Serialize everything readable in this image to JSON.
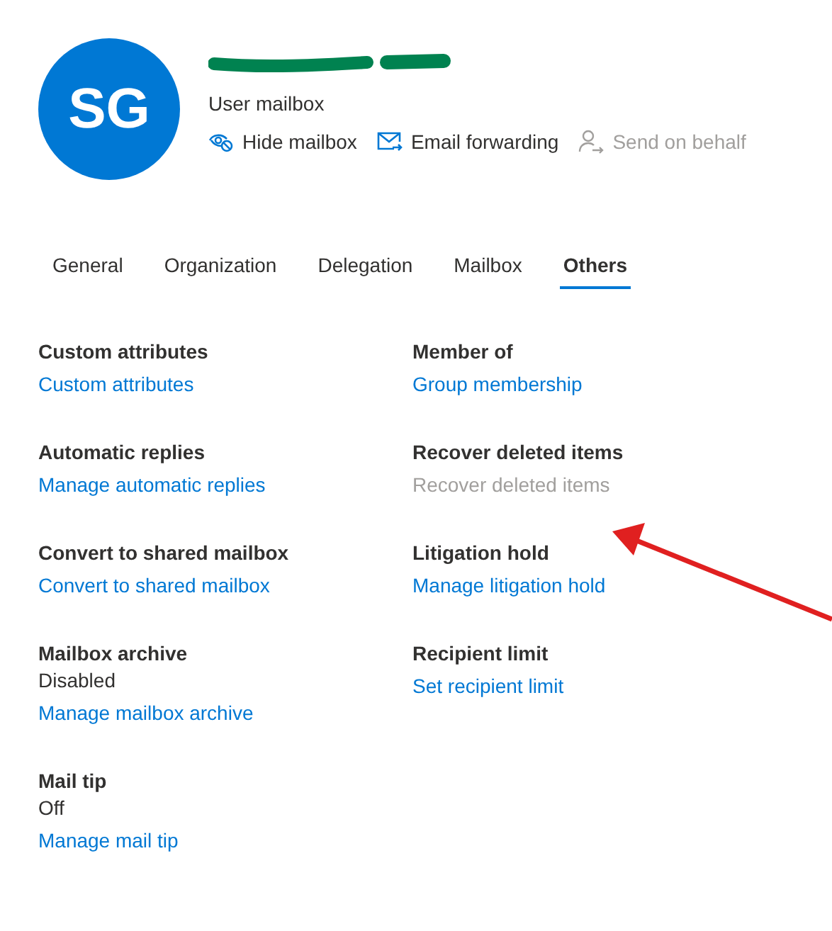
{
  "header": {
    "initials": "SG",
    "name_redacted": true,
    "subtitle": "User mailbox",
    "actions": [
      {
        "label": "Hide mailbox",
        "kind": "hide",
        "disabled": false
      },
      {
        "label": "Email forwarding",
        "kind": "forward",
        "disabled": false
      },
      {
        "label": "Send on behalf",
        "kind": "behalf",
        "disabled": true
      }
    ]
  },
  "tabs": [
    {
      "label": "General",
      "selected": false
    },
    {
      "label": "Organization",
      "selected": false
    },
    {
      "label": "Delegation",
      "selected": false
    },
    {
      "label": "Mailbox",
      "selected": false
    },
    {
      "label": "Others",
      "selected": true
    }
  ],
  "columns": [
    [
      {
        "title": "Custom attributes",
        "link": {
          "label": "Custom attributes",
          "disabled": false
        }
      },
      {
        "title": "Automatic replies",
        "link": {
          "label": "Manage automatic replies",
          "disabled": false
        }
      },
      {
        "title": "Convert to shared mailbox",
        "link": {
          "label": "Convert to shared mailbox",
          "disabled": false
        }
      },
      {
        "title": "Mailbox archive",
        "status": "Disabled",
        "link": {
          "label": "Manage mailbox archive",
          "disabled": false
        }
      },
      {
        "title": "Mail tip",
        "status": "Off",
        "link": {
          "label": "Manage mail tip",
          "disabled": false
        }
      }
    ],
    [
      {
        "title": "Member of",
        "link": {
          "label": "Group membership",
          "disabled": false
        }
      },
      {
        "title": "Recover deleted items",
        "link": {
          "label": "Recover deleted items",
          "disabled": true
        }
      },
      {
        "title": "Litigation hold",
        "link": {
          "label": "Manage litigation hold",
          "disabled": false
        }
      },
      {
        "title": "Recipient limit",
        "link": {
          "label": "Set recipient limit",
          "disabled": false
        }
      }
    ]
  ],
  "annotations": [
    {
      "kind": "arrow",
      "color": "#e02020"
    }
  ]
}
